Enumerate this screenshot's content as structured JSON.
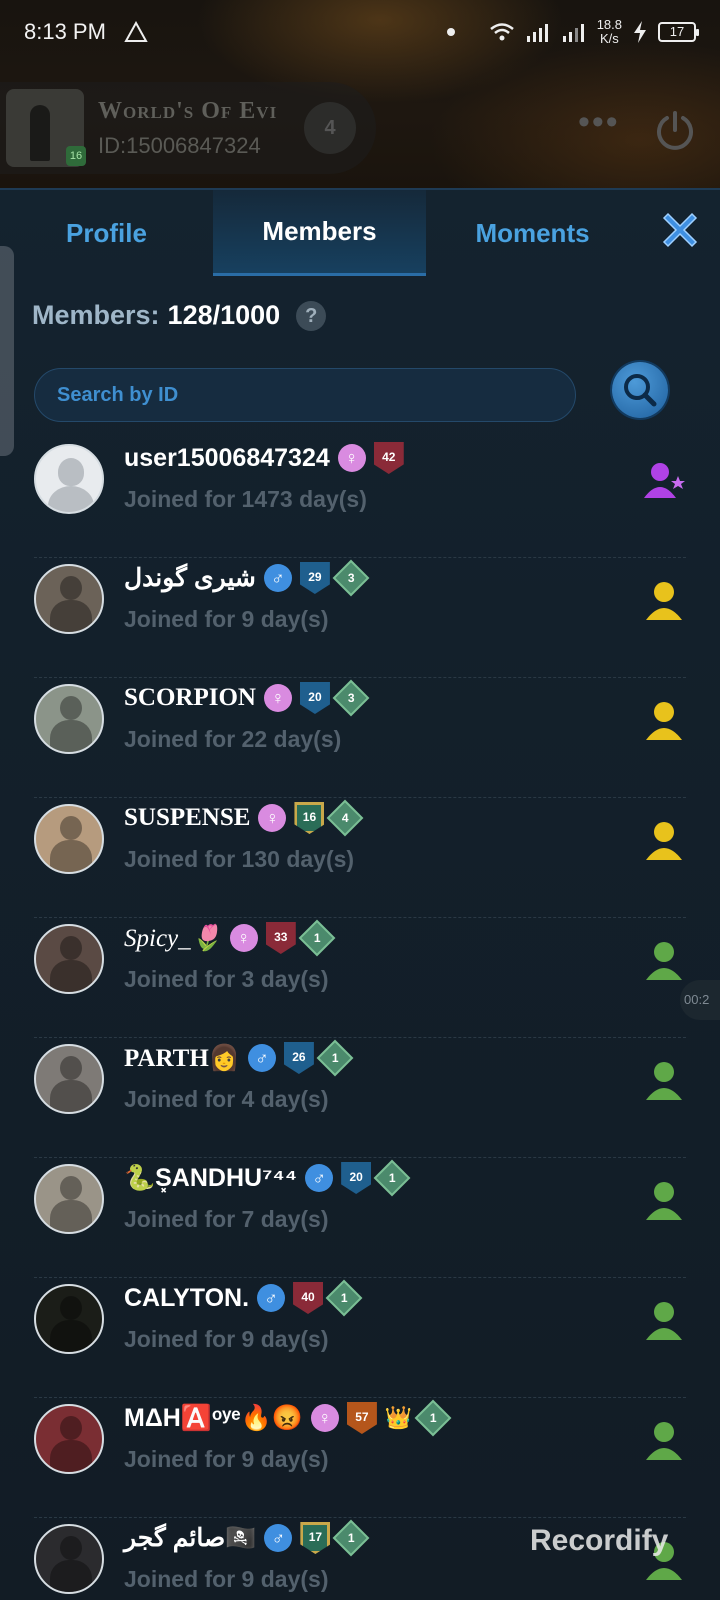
{
  "status_bar": {
    "time": "8:13 PM",
    "net_speed_value": "18.8",
    "net_speed_unit": "K/s",
    "battery": "17"
  },
  "group": {
    "name": "World's Of Evi",
    "id_text": "ID:15006847324",
    "level": "16",
    "rank": "4"
  },
  "tabs": [
    {
      "label": "Profile",
      "active": false
    },
    {
      "label": "Members",
      "active": true
    },
    {
      "label": "Moments",
      "active": false
    }
  ],
  "members_label": "Members:",
  "members_count": "128/1000",
  "search": {
    "placeholder": "Search by ID"
  },
  "members": [
    {
      "name": "user15006847324",
      "joined": "Joined for 1473 day(s)",
      "gender": "female",
      "level": "42",
      "role": "owner"
    },
    {
      "name": "شیری گوندل",
      "joined": "Joined for 9 day(s)",
      "gender": "male",
      "level": "29",
      "tier": "3",
      "role": "admin"
    },
    {
      "name": "SCORPION",
      "joined": "Joined for 22 day(s)",
      "gender": "female",
      "level": "20",
      "tier": "3",
      "role": "admin"
    },
    {
      "name": "SUSPENSE",
      "joined": "Joined for 130 day(s)",
      "gender": "female",
      "level": "16",
      "tier": "4",
      "role": "admin"
    },
    {
      "name": "Spicy_🌷",
      "joined": "Joined for 3 day(s)",
      "gender": "female",
      "level": "33",
      "tier": "1",
      "role": "member"
    },
    {
      "name": "PARTH👩",
      "joined": "Joined for 4 day(s)",
      "gender": "male",
      "level": "26",
      "tier": "1",
      "role": "member"
    },
    {
      "name": "🐍S͓ANDHU⁷⁴⁴",
      "joined": "Joined for 7 day(s)",
      "gender": "male",
      "level": "20",
      "tier": "1",
      "role": "member"
    },
    {
      "name": "CALYTON.",
      "joined": "Joined for 9 day(s)",
      "gender": "male",
      "level": "40",
      "tier": "1",
      "role": "member"
    },
    {
      "name": "MΔH🅰️ᵒʸᵉ🔥😡",
      "joined": "Joined for 9 day(s)",
      "gender": "female",
      "level": "57",
      "tier": "1",
      "role": "member",
      "extra": "👑"
    },
    {
      "name": "صائم گجر🏴‍☠️",
      "joined": "Joined for 9 day(s)",
      "gender": "male",
      "level": "17",
      "tier": "1",
      "role": "member"
    }
  ],
  "recording_timer": "00:2",
  "watermark": "Recordify",
  "colors": {
    "accent_blue": "#4aa2e0",
    "role_owner": "#b042e6",
    "role_admin": "#e8c21c",
    "role_member": "#5fa848"
  }
}
